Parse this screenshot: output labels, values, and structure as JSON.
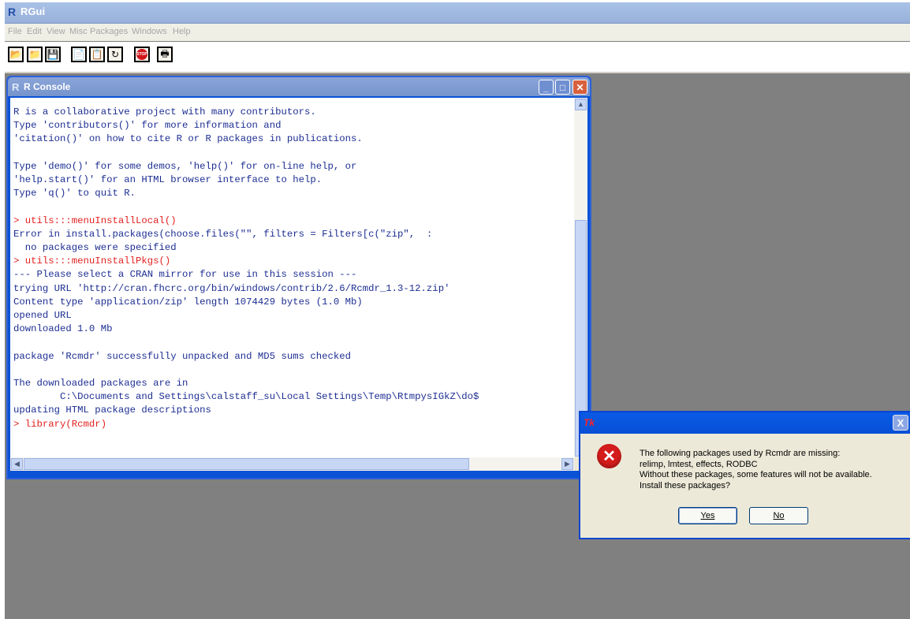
{
  "app": {
    "title": "RGui",
    "logo": "R"
  },
  "menubar": {
    "items": [
      "File",
      "Edit",
      "View",
      "Misc",
      "Packages",
      "Windows",
      "Help"
    ]
  },
  "toolbar": {
    "buttons": [
      {
        "name": "open-script-icon",
        "glyph": "📂"
      },
      {
        "name": "load-workspace-icon",
        "glyph": "📁"
      },
      {
        "name": "save-icon",
        "glyph": "💾"
      },
      {
        "name": "copy-icon",
        "glyph": "📄"
      },
      {
        "name": "paste-icon",
        "glyph": "📋"
      },
      {
        "name": "refresh-icon",
        "glyph": "↻"
      },
      {
        "name": "stop-icon",
        "glyph": "STOP"
      },
      {
        "name": "print-icon",
        "glyph": "🖶"
      }
    ]
  },
  "console": {
    "title": "R Console",
    "logo": "R",
    "lines": [
      {
        "text": "R is a collaborative project with many contributors.",
        "color": "blue"
      },
      {
        "text": "Type 'contributors()' for more information and",
        "color": "blue"
      },
      {
        "text": "'citation()' on how to cite R or R packages in publications.",
        "color": "blue"
      },
      {
        "text": "",
        "color": "blue"
      },
      {
        "text": "Type 'demo()' for some demos, 'help()' for on-line help, or",
        "color": "blue"
      },
      {
        "text": "'help.start()' for an HTML browser interface to help.",
        "color": "blue"
      },
      {
        "text": "Type 'q()' to quit R.",
        "color": "blue"
      },
      {
        "text": "",
        "color": "blue"
      },
      {
        "text": "> utils:::menuInstallLocal()",
        "color": "red"
      },
      {
        "text": "Error in install.packages(choose.files(\"\", filters = Filters[c(\"zip\",  :",
        "color": "blue"
      },
      {
        "text": "  no packages were specified",
        "color": "blue"
      },
      {
        "text": "> utils:::menuInstallPkgs()",
        "color": "red"
      },
      {
        "text": "--- Please select a CRAN mirror for use in this session ---",
        "color": "blue"
      },
      {
        "text": "trying URL 'http://cran.fhcrc.org/bin/windows/contrib/2.6/Rcmdr_1.3-12.zip'",
        "color": "blue"
      },
      {
        "text": "Content type 'application/zip' length 1074429 bytes (1.0 Mb)",
        "color": "blue"
      },
      {
        "text": "opened URL",
        "color": "blue"
      },
      {
        "text": "downloaded 1.0 Mb",
        "color": "blue"
      },
      {
        "text": "",
        "color": "blue"
      },
      {
        "text": "package 'Rcmdr' successfully unpacked and MD5 sums checked",
        "color": "blue"
      },
      {
        "text": "",
        "color": "blue"
      },
      {
        "text": "The downloaded packages are in",
        "color": "blue"
      },
      {
        "text": "        C:\\Documents and Settings\\calstaff_su\\Local Settings\\Temp\\RtmpysIGkZ\\do$",
        "color": "blue"
      },
      {
        "text": "updating HTML package descriptions",
        "color": "blue"
      },
      {
        "text": "> library(Rcmdr)",
        "color": "red"
      }
    ]
  },
  "dialog": {
    "title_icon": "Tk",
    "close": "X",
    "message_lines": [
      "The following packages used by Rcmdr are missing:",
      " relimp, lmtest, effects, RODBC",
      "Without these packages, some features will not be available.",
      "Install these packages?"
    ],
    "yes_label": "Yes",
    "no_label": "No"
  },
  "colors": {
    "console_text": "#1d2e92",
    "console_prompt": "#e2221f",
    "dialog_titlebar": "#0a5ae6",
    "workspace": "#808080"
  }
}
